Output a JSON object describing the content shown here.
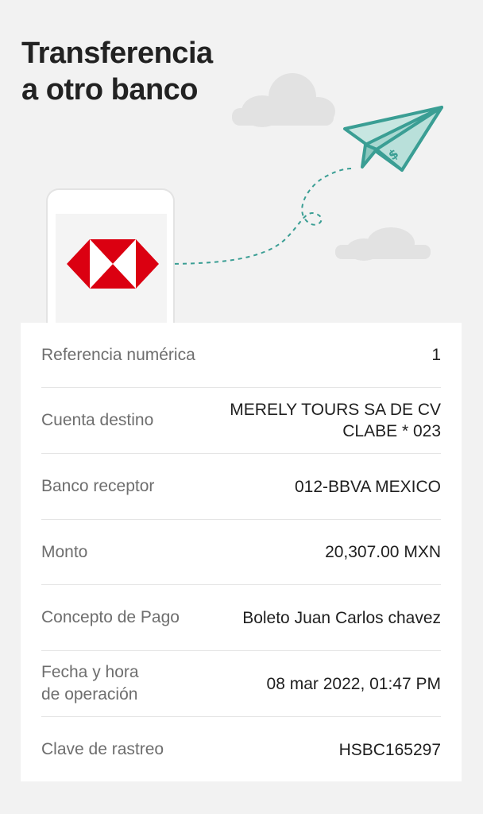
{
  "header": {
    "title": "Transferencia\na otro banco"
  },
  "colors": {
    "brand_red": "#db0011",
    "plane_teal": "#3a9e94",
    "plane_fill": "#b9e0da",
    "cloud": "#e2e2e2"
  },
  "illustration": {
    "logo_icon": "hsbc-hexagon-logo",
    "plane_icon": "paper-plane-money-icon",
    "trail": "dashed-trail"
  },
  "details": [
    {
      "label": "Referencia numérica",
      "value": "1"
    },
    {
      "label": "Cuenta destino",
      "value": "MERELY TOURS SA DE CV\nCLABE * 023"
    },
    {
      "label": "Banco receptor",
      "value": "012-BBVA MEXICO"
    },
    {
      "label": "Monto",
      "value": "20,307.00 MXN"
    },
    {
      "label": "Concepto de Pago",
      "value": "Boleto Juan Carlos chavez"
    },
    {
      "label": "Fecha y hora\nde operación",
      "value": "08 mar 2022, 01:47 PM"
    },
    {
      "label": "Clave de rastreo",
      "value": "HSBC165297"
    }
  ]
}
